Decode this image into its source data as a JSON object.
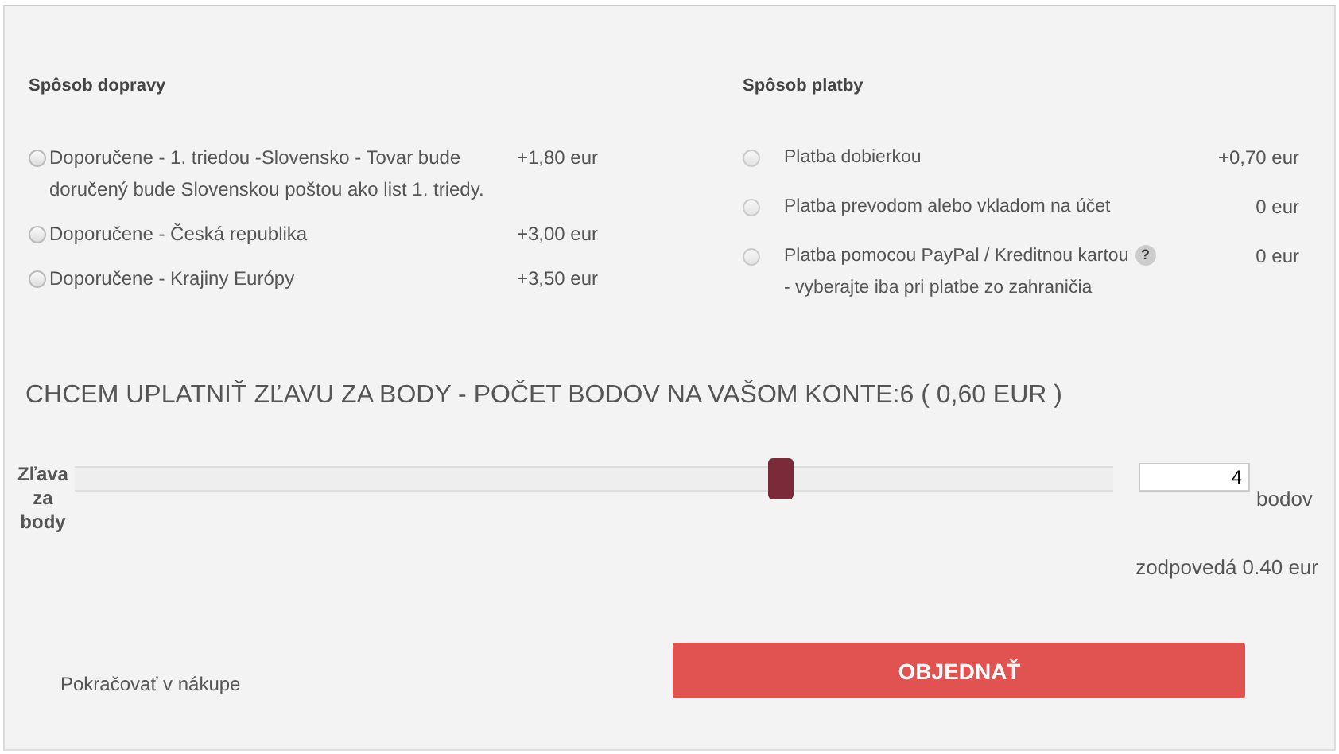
{
  "shipping": {
    "heading": "Spôsob dopravy",
    "options": [
      {
        "label": "Doporučene - 1. triedou -Slovensko - Tovar bude doručený bude Slovenskou poštou ako list 1. triedy.",
        "price": "+1,80 eur",
        "selected": false
      },
      {
        "label": "Doporučene - Česká republika",
        "price": "+3,00 eur",
        "selected": false
      },
      {
        "label": "Doporučene - Krajiny Európy",
        "price": "+3,50 eur",
        "selected": false
      }
    ]
  },
  "payment": {
    "heading": "Spôsob platby",
    "options": [
      {
        "label": "Platba dobierkou",
        "price": "+0,70 eur",
        "selected": false,
        "help": false
      },
      {
        "label": "Platba prevodom alebo vkladom na účet",
        "price": "0 eur",
        "selected": false,
        "help": false
      },
      {
        "label": "Platba pomocou PayPal / Kreditnou kartou",
        "note": "- vyberajte iba pri platbe zo zahraničia",
        "help_mark": "?",
        "price": "0 eur",
        "selected": false,
        "help": true
      }
    ]
  },
  "points": {
    "heading": "CHCEM UPLATNIŤ ZĽAVU ZA BODY - POČET BODOV NA VAŠOM KONTE:6 ( 0,60 EUR )",
    "slider_label": "Zľava za body",
    "level": 0.68,
    "value": "4",
    "unit": "bodov",
    "equivalent": "zodpovedá 0.40 eur"
  },
  "footer": {
    "continue_link": "Pokračovať v nákupe",
    "order_button": "OBJEDNAŤ"
  }
}
